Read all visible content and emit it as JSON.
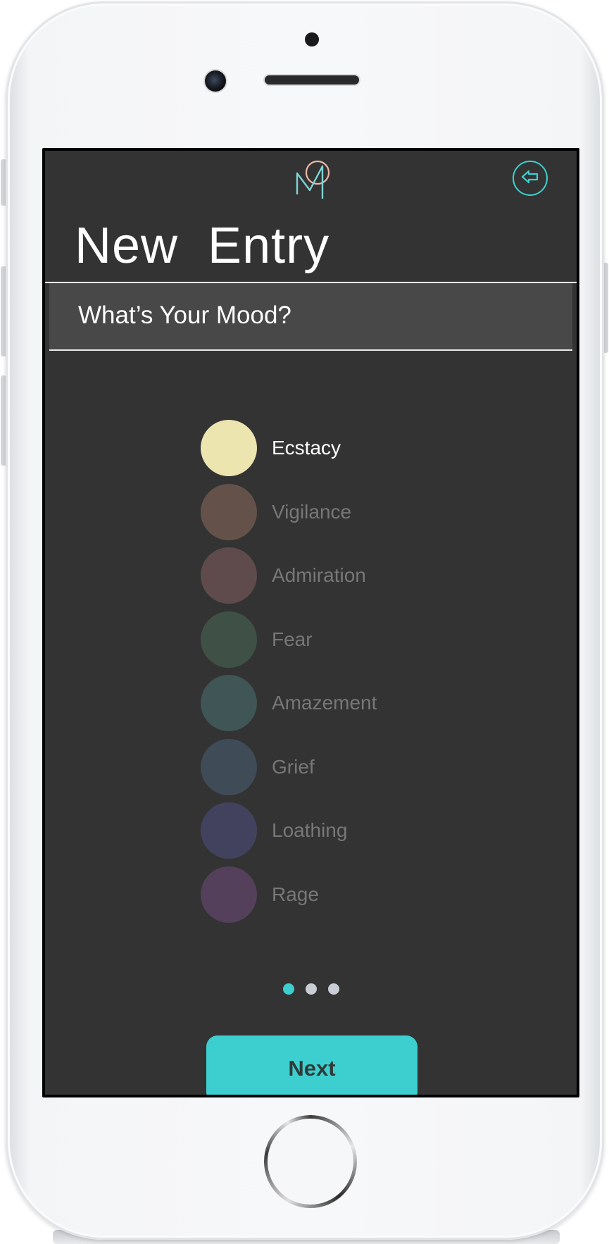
{
  "header": {
    "logo_icon": "monogram-logo-icon",
    "back_icon": "arrow-left-circle-icon",
    "title": "New  Entry",
    "subtitle": "What’s Your Mood?"
  },
  "colors": {
    "accent": "#3dcfd0",
    "background": "#333333",
    "subtitle_bar": "#484848"
  },
  "moods": [
    {
      "label": "Ecstacy",
      "color": "#ede5b0",
      "selected": true
    },
    {
      "label": "Vigilance",
      "color": "#64524a",
      "selected": false
    },
    {
      "label": "Admiration",
      "color": "#5f4b4c",
      "selected": false
    },
    {
      "label": "Fear",
      "color": "#3f5146",
      "selected": false
    },
    {
      "label": "Amazement",
      "color": "#3f5556",
      "selected": false
    },
    {
      "label": "Grief",
      "color": "#3f4b57",
      "selected": false
    },
    {
      "label": "Loathing",
      "color": "#43425e",
      "selected": false
    },
    {
      "label": "Rage",
      "color": "#54405a",
      "selected": false
    }
  ],
  "pagination": {
    "pages": 3,
    "current": 1
  },
  "footer": {
    "next_label": "Next"
  }
}
